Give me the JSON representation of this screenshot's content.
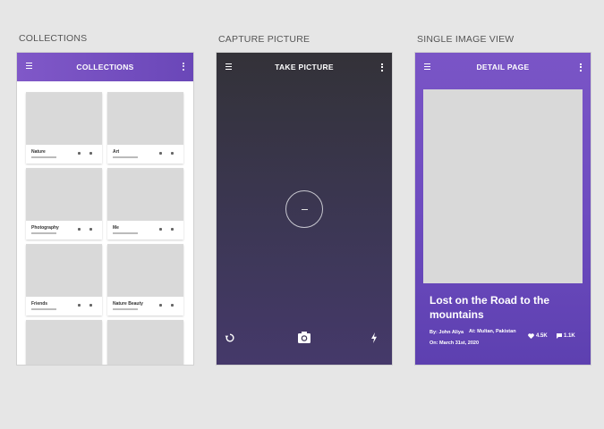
{
  "labels": {
    "collections": "COLLECTIONS",
    "capture": "CAPTURE PICTURE",
    "single": "SINGLE IMAGE VIEW"
  },
  "collections_screen": {
    "title": "COLLECTIONS",
    "cards": [
      {
        "name": "Nature"
      },
      {
        "name": "Art"
      },
      {
        "name": "Photography"
      },
      {
        "name": "Me"
      },
      {
        "name": "Friends"
      },
      {
        "name": "Nature Beauty"
      },
      {
        "name": ""
      },
      {
        "name": ""
      }
    ]
  },
  "capture_screen": {
    "title": "TAKE PICTURE"
  },
  "detail_screen": {
    "title": "DETAIL PAGE",
    "heading": "Lost on the Road to the mountains",
    "author": "By: John Aliya",
    "location": "At: Multan, Pakistan",
    "date": "On: March 31st, 2020",
    "likes": "4.5K",
    "comments": "1.1K"
  },
  "colors": {
    "accent": "#6a47b8",
    "camera_bg": "#3c3754",
    "placeholder": "#d9d9d9"
  }
}
